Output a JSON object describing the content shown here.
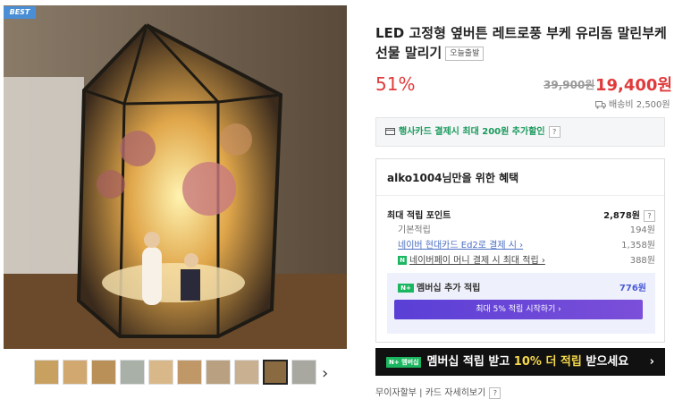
{
  "badge": "BEST",
  "product": {
    "title": "LED 고정형 옆버튼 레트로풍 부케 유리돔 말린부케 선물 말리기",
    "tag": "오늘출발",
    "discount": "51%",
    "original_price": "39,900원",
    "price": "19,400원",
    "shipping": "배송비 2,500원"
  },
  "card_promo": {
    "text": "행사카드 결제시 최대 200원 추가할인",
    "help": "?"
  },
  "benefit": {
    "title": "alko1004님만을 위한 혜택",
    "max_point_label": "최대 적립 포인트",
    "max_point_value": "2,878원",
    "help": "?",
    "rows": [
      {
        "label": "기본적립",
        "value": "194원"
      },
      {
        "label": "네이버 현대카드 Ed2로 결제 시 ›",
        "value": "1,358원"
      },
      {
        "label": "네이버페이 머니 결제 시 최대 적립 ›",
        "value": "388원"
      }
    ],
    "npay_icon": "N",
    "member_label": "멤버십 추가 적립",
    "member_value": "776원",
    "member_button": "최대 5% 적립 시작하기 ›"
  },
  "banner": {
    "badge": "N+ 멤버십",
    "text_pre": "멤버십 적립 받고 ",
    "text_hl": "10% 더 적립",
    "text_post": " 받으세요",
    "arrow": "›"
  },
  "footer": {
    "text": "무이자할부 | 카드 자세히보기",
    "help": "?"
  },
  "thumb_arrow": "›"
}
